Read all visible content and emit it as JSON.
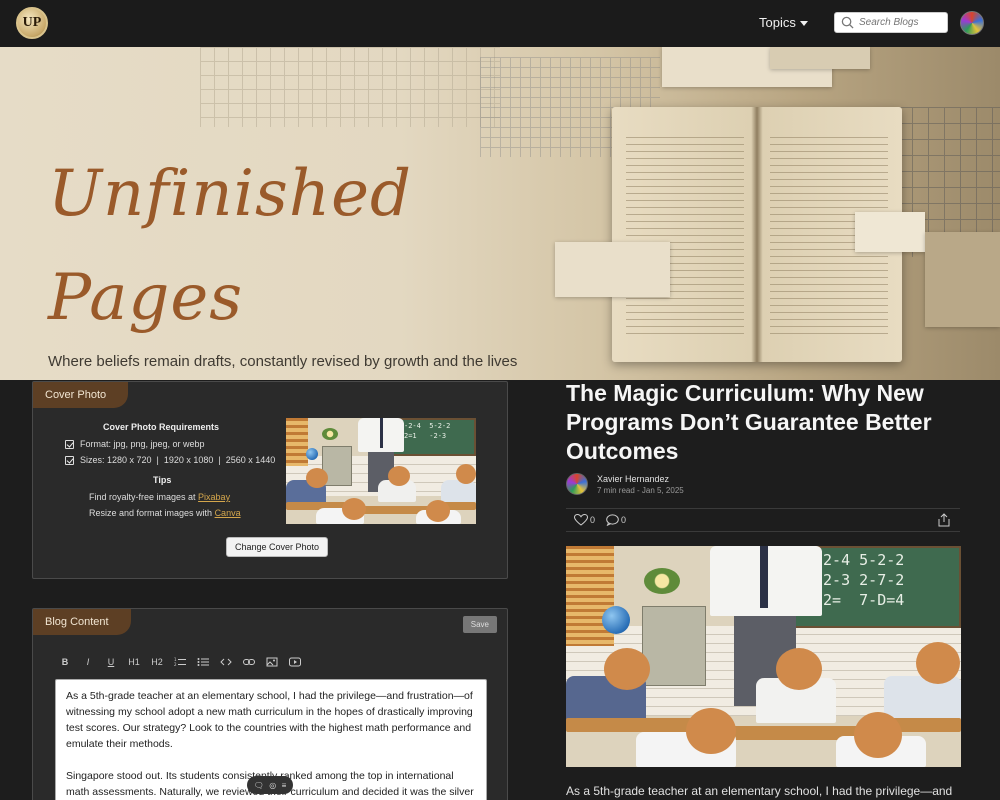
{
  "header": {
    "logo_text": "UP",
    "topics_label": "Topics",
    "search_placeholder": "Search Blogs"
  },
  "hero": {
    "title_line1": "Unfinished",
    "title_line2": "Pages",
    "tagline": "Where beliefs remain drafts, constantly revised by growth and the lives"
  },
  "cover_panel": {
    "tab_label": "Cover Photo",
    "requirements_title": "Cover Photo Requirements",
    "format_line": "Format: jpg, png, jpeg, or webp",
    "sizes_line": "Sizes: 1280 x 720  |  1920 x 1080  |  2560 x 1440",
    "tips_title": "Tips",
    "tip1_prefix": "Find royalty-free images at ",
    "tip1_link": "Pixabay",
    "tip2_prefix": "Resize and format images with ",
    "tip2_link": "Canva",
    "change_button": "Change Cover Photo"
  },
  "content_panel": {
    "tab_label": "Blog Content",
    "save_button": "Save",
    "toolbar": [
      "B",
      "I",
      "U",
      "H1",
      "H2",
      "ordered-list-icon",
      "bullet-list-icon",
      "code-icon",
      "link-icon",
      "image-icon",
      "video-icon"
    ],
    "paragraph1": "As a 5th-grade teacher at an elementary school, I had the privilege—and frustration—of witnessing my school adopt a new math curriculum in the hopes of drastically improving test scores. Our strategy? Look to the countries with the highest math performance and emulate their methods.",
    "paragraph2": "Singapore stood out. Its students consistently ranked among the top in international math assessments. Naturally, we reviewed their curriculum and decided it was the silver bullet we needed."
  },
  "article": {
    "title": "The Magic Curriculum: Why New Programs Don’t Guarantee Better Outcomes",
    "author": "Xavier Hernandez",
    "meta": "7 min read - Jan 5, 2025",
    "likes": "0",
    "comments": "0",
    "excerpt": "As a 5th-grade teacher at an elementary school, I had the privilege—and"
  },
  "colors": {
    "accent_brown": "#5d3f24",
    "link_gold": "#d4a64c",
    "background": "#1d1d1d"
  }
}
